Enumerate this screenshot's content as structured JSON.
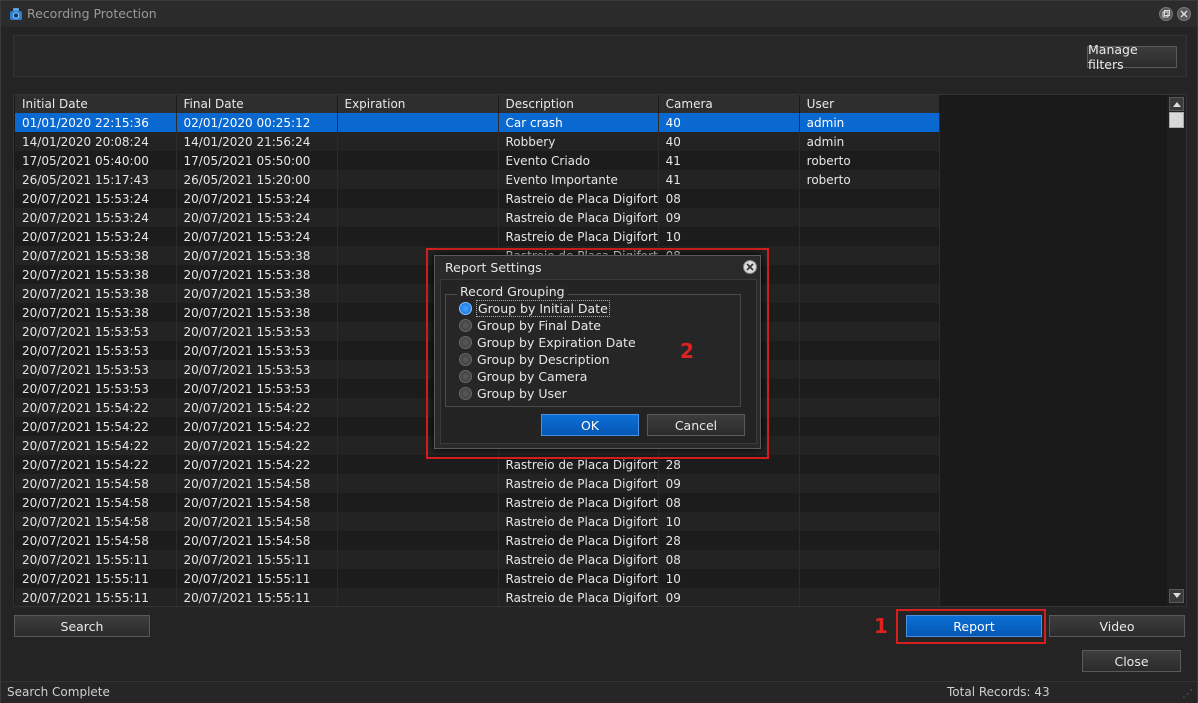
{
  "window": {
    "title": "Recording Protection"
  },
  "filters": {
    "manage_label": "Manage filters"
  },
  "table": {
    "columns": [
      "Initial Date",
      "Final Date",
      "Expiration",
      "Description",
      "Camera",
      "User"
    ],
    "rows": [
      [
        "01/01/2020 22:15:36",
        "02/01/2020 00:25:12",
        "",
        "Car crash",
        "40",
        "admin"
      ],
      [
        "14/01/2020 20:08:24",
        "14/01/2020 21:56:24",
        "",
        "Robbery",
        "40",
        "admin"
      ],
      [
        "17/05/2021 05:40:00",
        "17/05/2021 05:50:00",
        "",
        "Evento Criado",
        "41",
        "roberto"
      ],
      [
        "26/05/2021 15:17:43",
        "26/05/2021 15:20:00",
        "",
        "Evento Importante",
        "41",
        "roberto"
      ],
      [
        "20/07/2021 15:53:24",
        "20/07/2021 15:53:24",
        "",
        "Rastreio de Placa Digifort",
        "08",
        ""
      ],
      [
        "20/07/2021 15:53:24",
        "20/07/2021 15:53:24",
        "",
        "Rastreio de Placa Digifort",
        "09",
        ""
      ],
      [
        "20/07/2021 15:53:24",
        "20/07/2021 15:53:24",
        "",
        "Rastreio de Placa Digifort",
        "10",
        ""
      ],
      [
        "20/07/2021 15:53:38",
        "20/07/2021 15:53:38",
        "",
        "Rastreio de Placa Digifort",
        "08",
        ""
      ],
      [
        "20/07/2021 15:53:38",
        "20/07/2021 15:53:38",
        "",
        "",
        "",
        ""
      ],
      [
        "20/07/2021 15:53:38",
        "20/07/2021 15:53:38",
        "",
        "",
        "",
        ""
      ],
      [
        "20/07/2021 15:53:38",
        "20/07/2021 15:53:38",
        "",
        "",
        "",
        ""
      ],
      [
        "20/07/2021 15:53:53",
        "20/07/2021 15:53:53",
        "",
        "",
        "",
        ""
      ],
      [
        "20/07/2021 15:53:53",
        "20/07/2021 15:53:53",
        "",
        "",
        "",
        ""
      ],
      [
        "20/07/2021 15:53:53",
        "20/07/2021 15:53:53",
        "",
        "",
        "",
        ""
      ],
      [
        "20/07/2021 15:53:53",
        "20/07/2021 15:53:53",
        "",
        "",
        "",
        ""
      ],
      [
        "20/07/2021 15:54:22",
        "20/07/2021 15:54:22",
        "",
        "",
        "",
        ""
      ],
      [
        "20/07/2021 15:54:22",
        "20/07/2021 15:54:22",
        "",
        "",
        "",
        ""
      ],
      [
        "20/07/2021 15:54:22",
        "20/07/2021 15:54:22",
        "",
        "",
        "",
        ""
      ],
      [
        "20/07/2021 15:54:22",
        "20/07/2021 15:54:22",
        "",
        "Rastreio de Placa Digifort",
        "28",
        ""
      ],
      [
        "20/07/2021 15:54:58",
        "20/07/2021 15:54:58",
        "",
        "Rastreio de Placa Digifort",
        "09",
        ""
      ],
      [
        "20/07/2021 15:54:58",
        "20/07/2021 15:54:58",
        "",
        "Rastreio de Placa Digifort",
        "08",
        ""
      ],
      [
        "20/07/2021 15:54:58",
        "20/07/2021 15:54:58",
        "",
        "Rastreio de Placa Digifort",
        "10",
        ""
      ],
      [
        "20/07/2021 15:54:58",
        "20/07/2021 15:54:58",
        "",
        "Rastreio de Placa Digifort",
        "28",
        ""
      ],
      [
        "20/07/2021 15:55:11",
        "20/07/2021 15:55:11",
        "",
        "Rastreio de Placa Digifort",
        "08",
        ""
      ],
      [
        "20/07/2021 15:55:11",
        "20/07/2021 15:55:11",
        "",
        "Rastreio de Placa Digifort",
        "10",
        ""
      ],
      [
        "20/07/2021 15:55:11",
        "20/07/2021 15:55:11",
        "",
        "Rastreio de Placa Digifort",
        "09",
        ""
      ]
    ]
  },
  "buttons": {
    "search": "Search",
    "report": "Report",
    "video": "Video",
    "close": "Close"
  },
  "status": {
    "left": "Search Complete",
    "right": "Total Records: 43"
  },
  "annotations": {
    "one": "1",
    "two": "2"
  },
  "dialog": {
    "title": "Report Settings",
    "group_title": "Record Grouping",
    "options": [
      "Group by Initial Date",
      "Group by Final Date",
      "Group by Expiration Date",
      "Group by Description",
      "Group by Camera",
      "Group by User"
    ],
    "selected_index": 0,
    "ok": "OK",
    "cancel": "Cancel"
  },
  "colors": {
    "accent": "#0a69d0",
    "annotation": "#d51f1f"
  },
  "icons": {
    "app": "camera-shield-icon",
    "restore": "restore-icon",
    "close": "close-icon"
  }
}
